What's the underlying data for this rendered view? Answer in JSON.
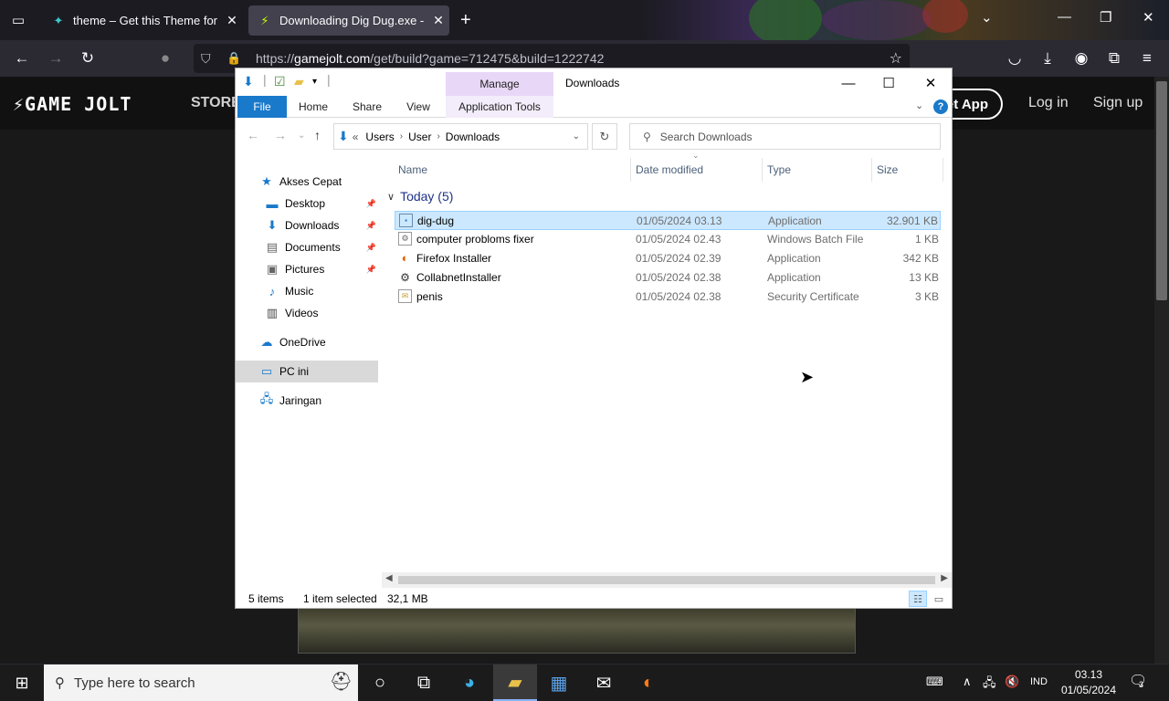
{
  "browser": {
    "tabs": [
      {
        "title": "theme – Get this Theme for"
      },
      {
        "title": "Downloading Dig Dug.exe - Ga"
      }
    ],
    "url_prefix": "https://",
    "url_domain": "gamejolt.com",
    "url_path": "/get/build?game=712475&build=1222742"
  },
  "gamejolt": {
    "logo": "GAME JOLT",
    "store": "STORE",
    "get_app": "et App",
    "login": "Log in",
    "signup": "Sign up"
  },
  "explorer": {
    "window_title": "Downloads",
    "contextual_tab": "Manage",
    "ribbon_tabs": {
      "file": "File",
      "home": "Home",
      "share": "Share",
      "view": "View",
      "app_tools": "Application Tools"
    },
    "breadcrumb": {
      "overflow": "«",
      "items": [
        "Users",
        "User",
        "Downloads"
      ]
    },
    "search_placeholder": "Search Downloads",
    "nav": [
      {
        "label": "Akses Cepat",
        "icon": "star-icon"
      },
      {
        "label": "Desktop",
        "icon": "desktop-icon",
        "pinned": true
      },
      {
        "label": "Downloads",
        "icon": "download-icon",
        "pinned": true
      },
      {
        "label": "Documents",
        "icon": "documents-icon",
        "pinned": true
      },
      {
        "label": "Pictures",
        "icon": "pictures-icon",
        "pinned": true
      },
      {
        "label": "Music",
        "icon": "music-icon"
      },
      {
        "label": "Videos",
        "icon": "videos-icon"
      },
      {
        "label": "OneDrive",
        "icon": "cloud-icon"
      },
      {
        "label": "PC ini",
        "icon": "computer-icon",
        "selected": true
      },
      {
        "label": "Jaringan",
        "icon": "network-icon"
      }
    ],
    "columns": {
      "name": "Name",
      "date": "Date modified",
      "type": "Type",
      "size": "Size"
    },
    "group_label": "Today (5)",
    "files": [
      {
        "name": "dig-dug",
        "date": "01/05/2024 03.13",
        "type": "Application",
        "size": "32.901 KB",
        "selected": true
      },
      {
        "name": "computer probloms fixer",
        "date": "01/05/2024 02.43",
        "type": "Windows Batch File",
        "size": "1 KB"
      },
      {
        "name": "Firefox Installer",
        "date": "01/05/2024 02.39",
        "type": "Application",
        "size": "342 KB"
      },
      {
        "name": "CollabnetInstaller",
        "date": "01/05/2024 02.38",
        "type": "Application",
        "size": "13 KB"
      },
      {
        "name": "penis",
        "date": "01/05/2024 02.38",
        "type": "Security Certificate",
        "size": "3 KB"
      }
    ],
    "status": {
      "items": "5 items",
      "selection": "1 item selected",
      "selection_size": "32,1 MB"
    }
  },
  "taskbar": {
    "search_placeholder": "Type here to search",
    "lang": "IND",
    "time": "03.13",
    "date": "01/05/2024",
    "notifications": "3"
  },
  "colors": {
    "accent_blue": "#1979ca",
    "selection": "#cce8ff",
    "manage_tab": "#e9d7f7"
  }
}
